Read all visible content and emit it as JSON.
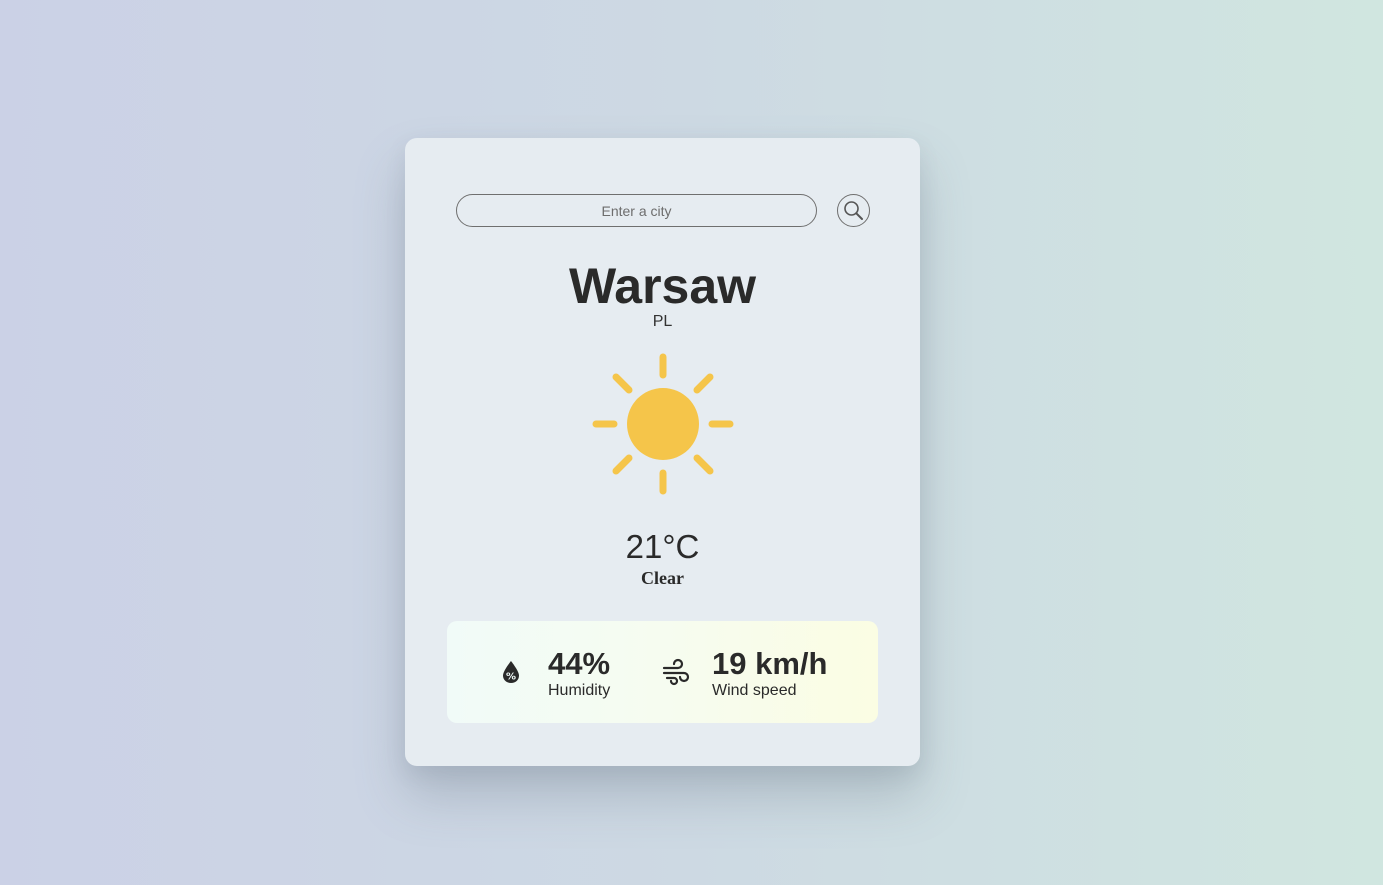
{
  "search": {
    "placeholder": "Enter a city",
    "value": "",
    "button_icon": "search-icon"
  },
  "location": {
    "city": "Warsaw",
    "country": "PL"
  },
  "weather": {
    "icon": "sun-icon",
    "temperature": "21°C",
    "description": "Clear",
    "sun_color": "#f5c54a"
  },
  "stats": {
    "humidity": {
      "icon": "humidity-drop-icon",
      "value": "44%",
      "label": "Humidity"
    },
    "wind": {
      "icon": "wind-icon",
      "value": "19 km/h",
      "label": "Wind speed"
    }
  }
}
